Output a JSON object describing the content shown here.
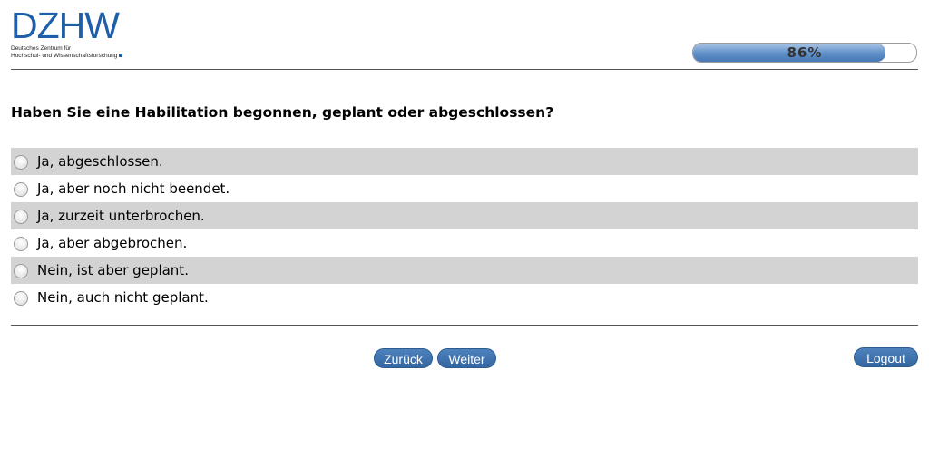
{
  "logo": {
    "mark": "DZHW",
    "subtitle_line1": "Deutsches Zentrum für",
    "subtitle_line2": "Hochschul- und Wissenschaftsforschung"
  },
  "progress": {
    "value_percent": 86,
    "label": "86%"
  },
  "question": "Haben Sie eine Habilitation begonnen, geplant oder abgeschlossen?",
  "options": [
    {
      "label": "Ja, abgeschlossen.",
      "selected": false
    },
    {
      "label": "Ja, aber noch nicht beendet.",
      "selected": false
    },
    {
      "label": "Ja, zurzeit unterbrochen.",
      "selected": false
    },
    {
      "label": "Ja, aber abgebrochen.",
      "selected": false
    },
    {
      "label": "Nein, ist aber geplant.",
      "selected": false
    },
    {
      "label": "Nein, auch nicht geplant.",
      "selected": false
    }
  ],
  "buttons": {
    "back": "Zurück",
    "next": "Weiter",
    "logout": "Logout"
  },
  "colors": {
    "brand": "#1f5ea8",
    "button": "#3f73ae",
    "row_shade": "#d3d3d3"
  }
}
